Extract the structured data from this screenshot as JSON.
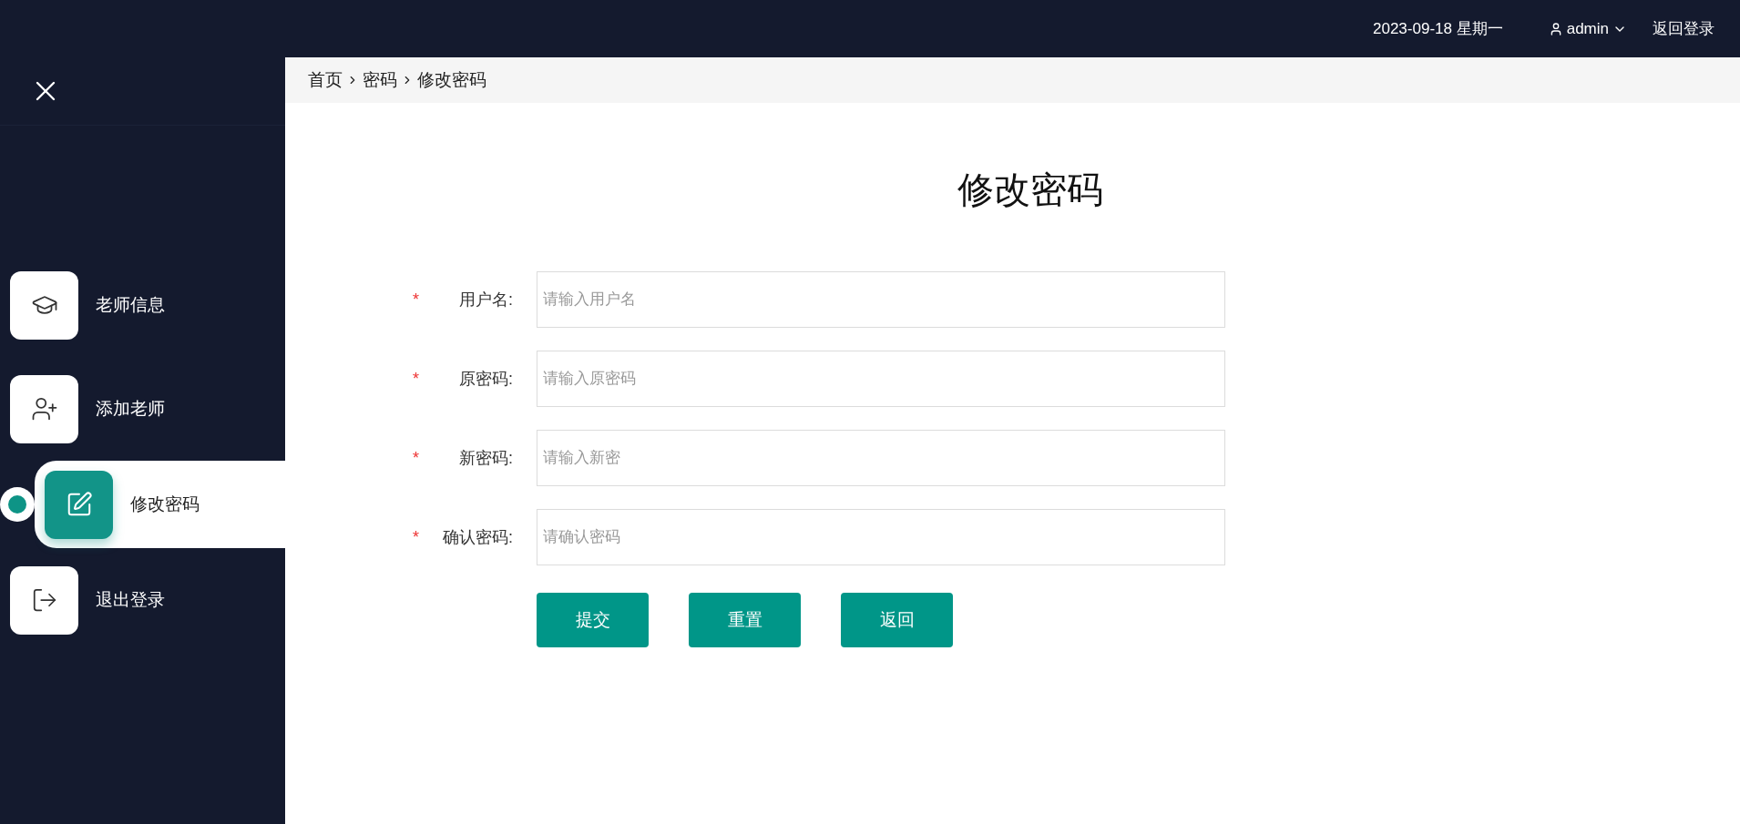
{
  "header": {
    "date": "2023-09-18 星期一",
    "user": "admin",
    "logout_link": "返回登录"
  },
  "sidebar": {
    "items": [
      {
        "label": "老师信息",
        "kind": "teacher",
        "selected": false
      },
      {
        "label": "添加老师",
        "kind": "add-user",
        "selected": false
      },
      {
        "label": "修改密码",
        "kind": "edit",
        "selected": true
      },
      {
        "label": "退出登录",
        "kind": "logout",
        "selected": false
      }
    ]
  },
  "breadcrumb": [
    "首页",
    "密码",
    "修改密码"
  ],
  "form": {
    "title": "修改密码",
    "fields": [
      {
        "label": "用户名:",
        "placeholder": "请输入用户名",
        "required_mark": "*"
      },
      {
        "label": "原密码:",
        "placeholder": "请输入原密码",
        "required_mark": "*"
      },
      {
        "label": "新密码:",
        "placeholder": "请输入新密",
        "required_mark": "*"
      },
      {
        "label": "确认密码:",
        "placeholder": "请确认密码",
        "required_mark": "*"
      }
    ],
    "buttons": [
      "提交",
      "重置",
      "返回"
    ]
  }
}
